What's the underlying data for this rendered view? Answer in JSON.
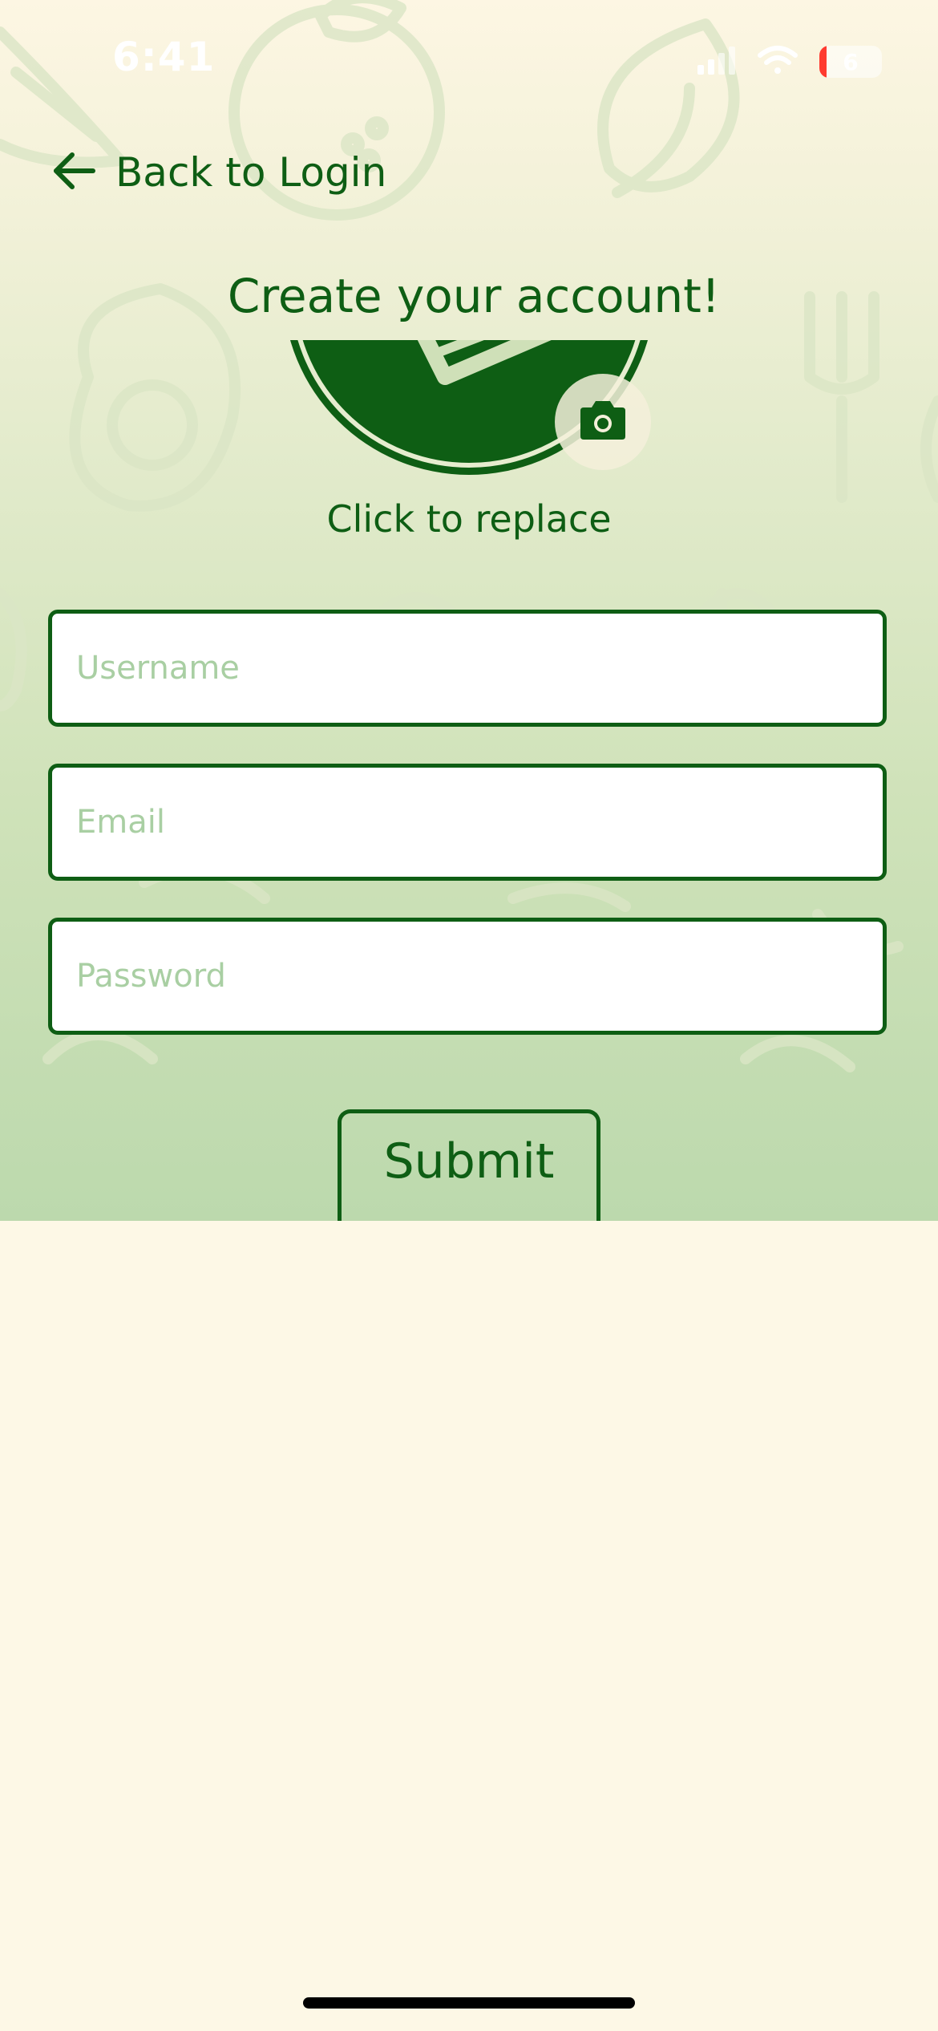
{
  "status_bar": {
    "time": "6:41",
    "battery_level": "6",
    "battery_fraction": 0.06
  },
  "nav": {
    "back_label": "Back to Login"
  },
  "header": {
    "title": "Create your account!"
  },
  "avatar": {
    "replace_label": "Click to replace"
  },
  "form": {
    "username_placeholder": "Username",
    "email_placeholder": "Email",
    "password_placeholder": "Password",
    "submit_label": "Submit"
  },
  "colors": {
    "primary": "#0e5e14",
    "background": "#fdf8e6",
    "placeholder": "#a9cfa3",
    "battery_low": "#ff3b30"
  },
  "icons": [
    "signal-icon",
    "wifi-icon",
    "battery-icon",
    "back-arrow-icon",
    "camera-icon"
  ]
}
